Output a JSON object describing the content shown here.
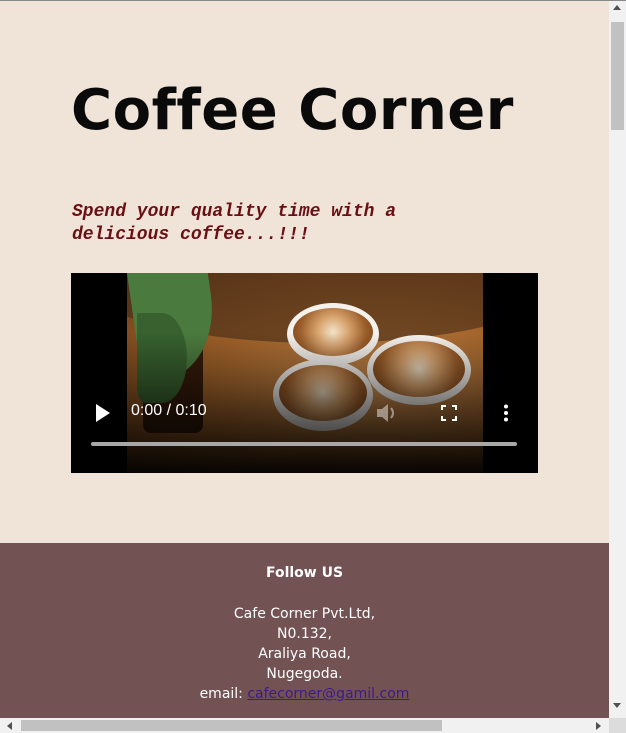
{
  "page": {
    "title": "Coffee Corner",
    "tagline": "Spend your quality time with a delicious coffee...!!!"
  },
  "video": {
    "time": "0:00 / 0:10",
    "progress_fraction": 0.0,
    "controls": [
      "play-icon",
      "mute-icon",
      "fullscreen-icon",
      "more-icon"
    ]
  },
  "footer": {
    "heading": "Follow US",
    "address_lines": [
      "Cafe Corner Pvt.Ltd,",
      "N0.132,",
      "Araliya Road,",
      "Nugegoda."
    ],
    "email_label": "email:",
    "email": "cafecorner@gamil.com"
  },
  "colors": {
    "page_bg": "#f0e4d9",
    "footer_bg": "#735254",
    "tagline": "#6b0f14",
    "link": "#3c1a8c"
  }
}
